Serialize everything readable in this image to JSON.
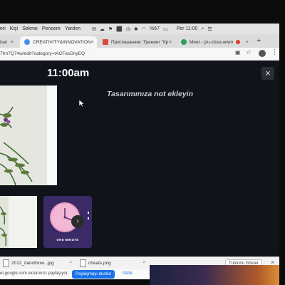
{
  "menubar": {
    "items": [
      "eri",
      "Kişi",
      "Sekme",
      "Pencere",
      "Yardım"
    ],
    "battery": "%67",
    "time": "Per 11:00"
  },
  "tabs": [
    {
      "label": "isel",
      "active": false
    },
    {
      "label": "CREATIVITY&INNOVATION",
      "active": true
    },
    {
      "label": "Приглашение: Тренинг \"Кр",
      "active": false
    },
    {
      "label": "Meet - jzu-zbso-wwm",
      "active": false
    }
  ],
  "address": {
    "url": "7frn7Q74w/edit?category=tACFasDnyEQ"
  },
  "editor": {
    "time_label": "11:00am",
    "close_symbol": "×",
    "note_placeholder": "Tasarımınıza not ekleyin",
    "thumb_caption": "ONE MINUTE",
    "next_symbol": "›"
  },
  "downloads": {
    "items": [
      "2012_itanothow...jpg",
      "cheats.png"
    ],
    "show_all": "Tümünü Göster"
  },
  "sharing": {
    "text": "et.google.com ekranınızı paylaşıyor.",
    "stop_label": "Paylaşmayı durdur",
    "hide_label": "Gizle"
  },
  "colors": {
    "editor_bg": "#10141a",
    "share_button": "#1a73e8",
    "thumb_bg": "#3a2a66",
    "clock_face": "#f3b8d6"
  },
  "icons": [
    "chrome-icon",
    "gmail-icon",
    "meet-icon",
    "wifi-icon",
    "battery-icon",
    "search-icon",
    "profile-icon",
    "more-icon",
    "download-file-icon",
    "cursor-icon"
  ]
}
